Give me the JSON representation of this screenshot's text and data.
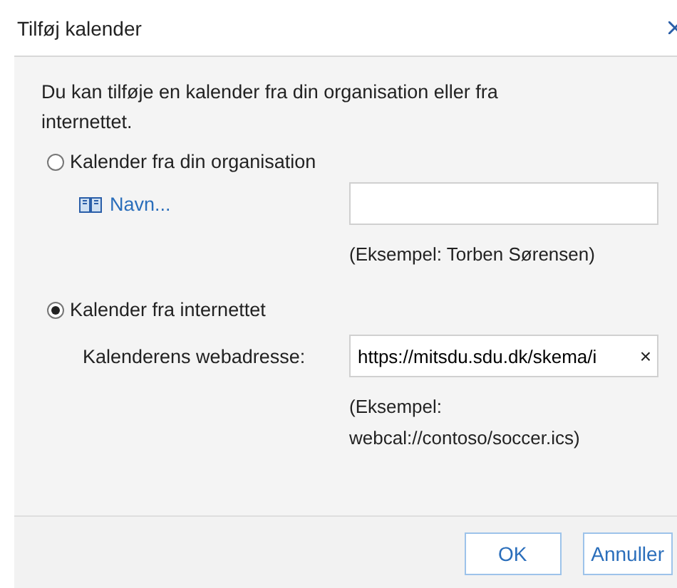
{
  "window": {
    "title": "Tilføj kalender"
  },
  "intro": "Du kan tilføje en kalender fra din organisation eller fra internettet.",
  "options": [
    {
      "label": "Kalender fra din organisation",
      "selected": false
    },
    {
      "label": "Kalender fra internettet",
      "selected": true
    }
  ],
  "organisation": {
    "link": "Navn...",
    "example": "(Eksempel: Torben Sørensen)"
  },
  "internet": {
    "label": "Kalenderens webadresse:",
    "value": "https://mitsdu.sdu.dk/skema/i",
    "clear": "×",
    "example": "(Eksempel: webcal://contoso/soccer.ics)"
  },
  "buttons": [
    "OK",
    "Annuller"
  ]
}
